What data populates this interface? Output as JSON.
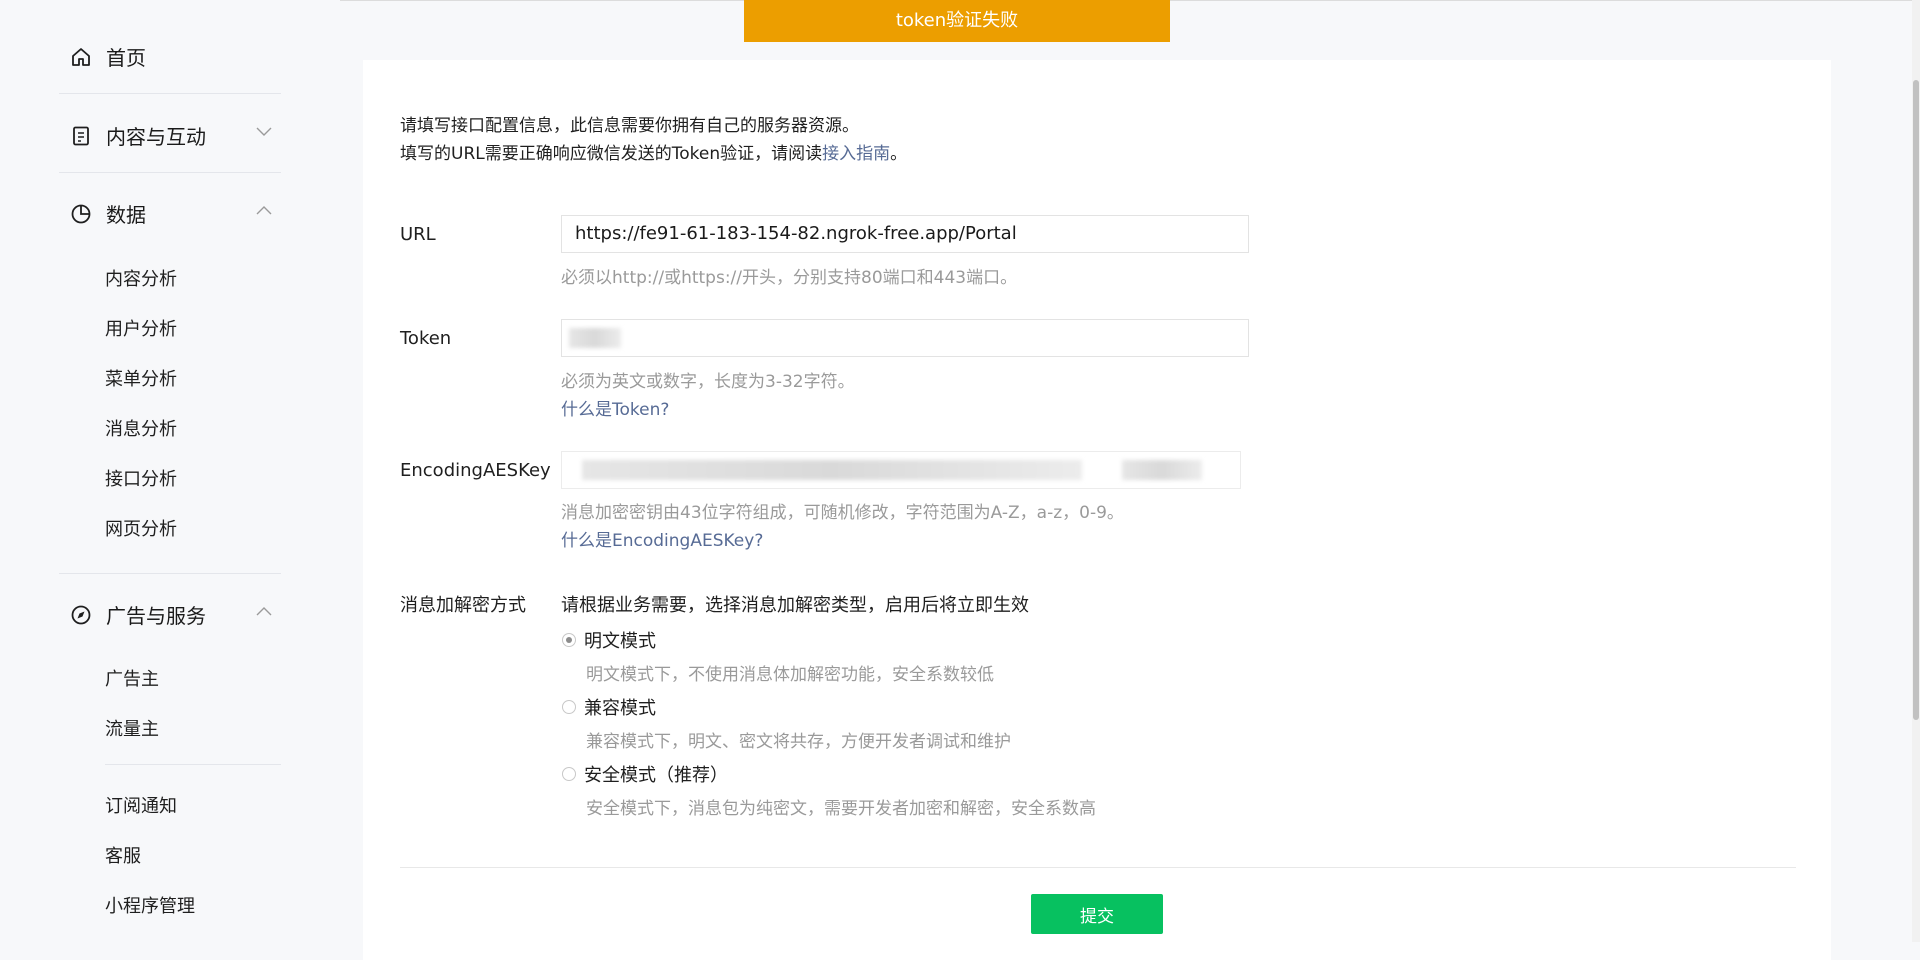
{
  "sidebar": {
    "home": "首页",
    "content_interaction": "内容与互动",
    "data": {
      "label": "数据",
      "items": [
        "内容分析",
        "用户分析",
        "菜单分析",
        "消息分析",
        "接口分析",
        "网页分析"
      ]
    },
    "ads": {
      "label": "广告与服务",
      "items": [
        "广告主",
        "流量主"
      ]
    },
    "others": [
      "订阅通知",
      "客服",
      "小程序管理"
    ]
  },
  "toast": "token验证失败",
  "intro": {
    "line1": "请填写接口配置信息，此信息需要你拥有自己的服务器资源。",
    "line2_prefix": "填写的URL需要正确响应微信发送的Token验证，请阅读",
    "line2_link": "接入指南",
    "line2_suffix": "。"
  },
  "form": {
    "url": {
      "label": "URL",
      "value": "https://fe91-61-183-154-82.ngrok-free.app/Portal",
      "hint": "必须以http://或https://开头，分别支持80端口和443端口。"
    },
    "token": {
      "label": "Token",
      "hint": "必须为英文或数字，长度为3-32字符。",
      "help": "什么是Token?"
    },
    "aes": {
      "label": "EncodingAESKey",
      "hint": "消息加密密钥由43位字符组成，可随机修改，字符范围为A-Z，a-z，0-9。",
      "help": "什么是EncodingAESKey?"
    },
    "encrypt": {
      "label": "消息加解密方式",
      "desc": "请根据业务需要，选择消息加解密类型，启用后将立即生效",
      "options": [
        {
          "label": "明文模式",
          "desc": "明文模式下，不使用消息体加解密功能，安全系数较低",
          "selected": true
        },
        {
          "label": "兼容模式",
          "desc": "兼容模式下，明文、密文将共存，方便开发者调试和维护",
          "selected": false
        },
        {
          "label": "安全模式（推荐）",
          "desc": "安全模式下，消息包为纯密文，需要开发者加密和解密，安全系数高",
          "selected": false
        }
      ]
    }
  },
  "submit": "提交"
}
